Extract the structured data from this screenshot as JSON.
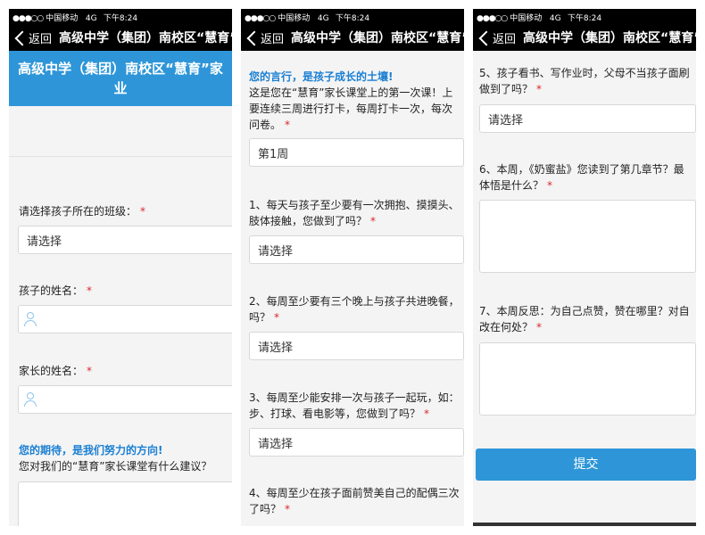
{
  "status_bar": {
    "signal": "●●●○○",
    "carrier": "中国移动",
    "network": "4G",
    "time": "下午8:24"
  },
  "nav": {
    "back_label": "返回",
    "title": "高级中学（集团）南校区“慧育”家长课堂"
  },
  "screen1": {
    "banner_line1": "高级中学（集团）南校区“慧育”家",
    "banner_line2": "业",
    "class_label": "请选择孩子所在的班级：",
    "class_value": "请选择",
    "child_name_label": "孩子的姓名：",
    "parent_name_label": "家长的姓名：",
    "expect_heading": "您的期待，是我们努力的方向!",
    "suggest_label": "您对我们的“慧育”家长课堂有什么建议？"
  },
  "screen2": {
    "heading": "您的言行，是孩子成长的土壤!",
    "intro_line1": "这是您在“慧育”家长课堂上的第一次课！上",
    "intro_line2": "要连续三周进行打卡，每周打卡一次，每次",
    "intro_line3": "问卷。",
    "week_value": "第1周",
    "q1_line1": "1、每天与孩子至少要有一次拥抱、摸摸头、",
    "q1_line2": "肢体接触，您做到了吗？",
    "q1_value": "请选择",
    "q2_line1": "2、每周至少要有三个晚上与孩子共进晚餐，",
    "q2_line2": "吗？",
    "q2_value": "请选择",
    "q3_line1": "3、每周至少能安排一次与孩子一起玩，如：",
    "q3_line2": "步、打球、看电影等，您做到了吗？",
    "q3_value": "请选择",
    "q4_line1": "4、每周至少在孩子面前赞美自己的配偶三次",
    "q4_line2": "了吗？"
  },
  "screen3": {
    "q5_line1": "5、孩子看书、写作业时，父母不当孩子面刷",
    "q5_line2": "做到了吗？",
    "q5_value": "请选择",
    "q6_line1": "6、本周，《奶蜜盐》您读到了第几章节？最",
    "q6_line2": "体悟是什么？",
    "q7_line1": "7、本周反思：为自己点赞，赞在哪里？对自",
    "q7_line2": "改在何处？",
    "submit_label": "提交"
  },
  "required_mark": "*",
  "colors": {
    "accent": "#2e96d8",
    "required": "#d9282f",
    "heading_blue": "#1a7fd3"
  }
}
